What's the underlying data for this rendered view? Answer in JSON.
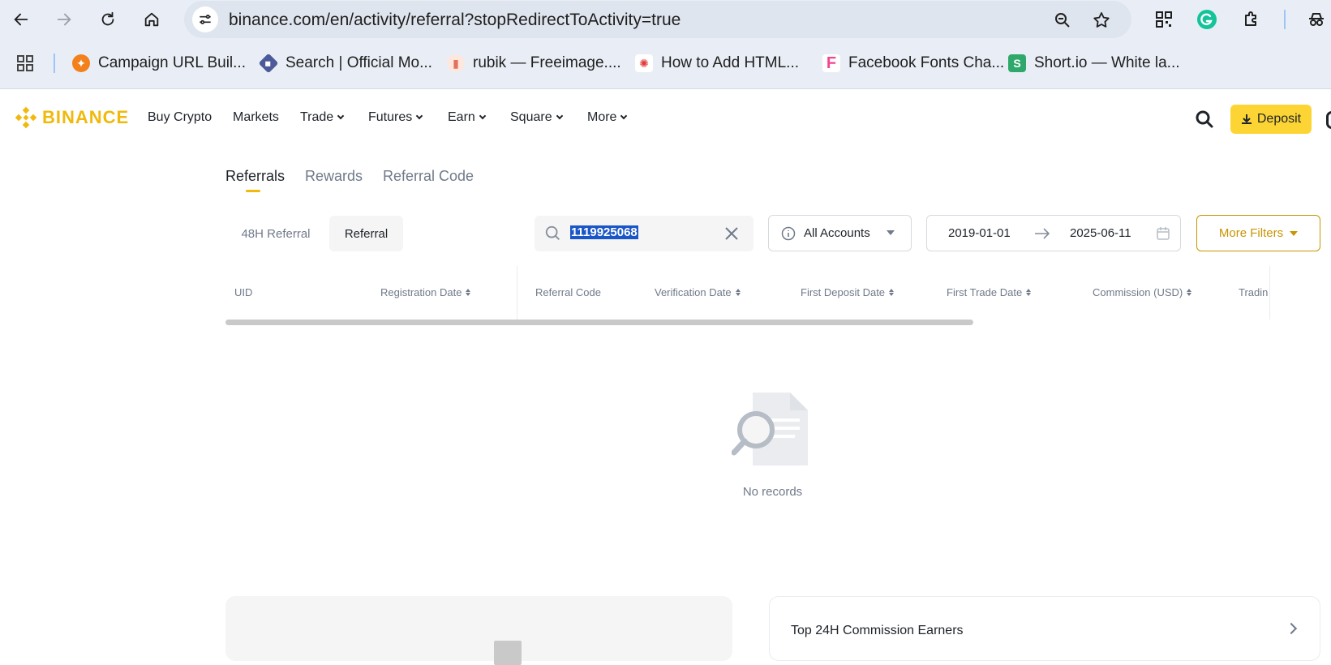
{
  "browser": {
    "url": "binance.com/en/activity/referral?stopRedirectToActivity=true",
    "bookmarks": [
      {
        "label": "Campaign URL Buil...",
        "color": "#f2811d"
      },
      {
        "label": "Search | Official Mo...",
        "color": "#4b5a9a"
      },
      {
        "label": "rubik — Freeimage....",
        "color": "#f1a38a"
      },
      {
        "label": "How to Add HTML...",
        "color": "#e43d3d"
      },
      {
        "label": "Facebook Fonts Cha...",
        "color": "#f1468d"
      },
      {
        "label": "Short.io — White la...",
        "color": "#2fa86b"
      }
    ]
  },
  "site": {
    "logo": "BINANCE",
    "menu": [
      {
        "label": "Buy Crypto",
        "dropdown": false
      },
      {
        "label": "Markets",
        "dropdown": false
      },
      {
        "label": "Trade",
        "dropdown": true
      },
      {
        "label": "Futures",
        "dropdown": true
      },
      {
        "label": "Earn",
        "dropdown": true
      },
      {
        "label": "Square",
        "dropdown": true
      },
      {
        "label": "More",
        "dropdown": true
      }
    ],
    "deposit_label": "Deposit",
    "accent": "#fcd535"
  },
  "page": {
    "tabs": [
      "Referrals",
      "Rewards",
      "Referral Code"
    ],
    "active_tab": "Referrals",
    "segments": [
      "48H Referral",
      "Referral"
    ],
    "active_segment": "Referral",
    "search_value": "1119925068",
    "account_select": "All Accounts",
    "date_from": "2019-01-01",
    "date_to": "2025-06-11",
    "more_filters": "More Filters"
  },
  "table": {
    "columns": [
      {
        "label": "UID",
        "sortable": false
      },
      {
        "label": "Registration Date",
        "sortable": true
      },
      {
        "label": "Referral Code",
        "sortable": false
      },
      {
        "label": "Verification Date",
        "sortable": true
      },
      {
        "label": "First Deposit Date",
        "sortable": true
      },
      {
        "label": "First Trade Date",
        "sortable": true
      },
      {
        "label": "Commission (USD)",
        "sortable": true
      },
      {
        "label": "Tradin",
        "sortable": false
      }
    ],
    "empty_text": "No records"
  },
  "cards": {
    "top_earners_title": "Top 24H Commission Earners"
  }
}
